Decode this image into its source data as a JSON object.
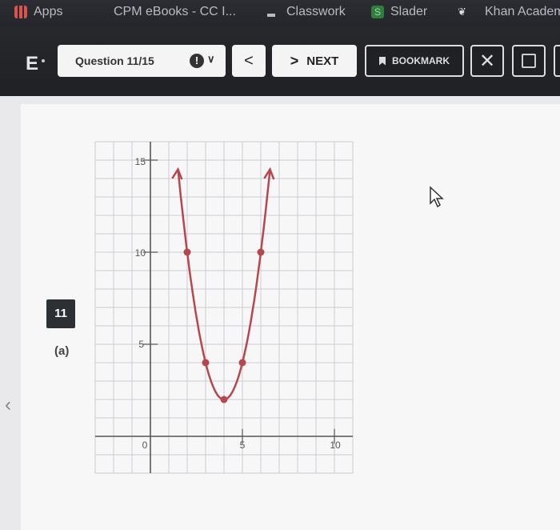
{
  "bookmarks_bar": {
    "items": [
      {
        "label": "Apps",
        "icon": "apps-grid-icon",
        "color": "#d9534f"
      },
      {
        "label": "CPM eBooks - CC I...",
        "icon": "cpm-icon",
        "color": "#888888"
      },
      {
        "label": "Classwork",
        "icon": "classroom-icon",
        "color": "#bbbbbb"
      },
      {
        "label": "Slader",
        "icon": "slader-icon",
        "color": "#3aa655"
      },
      {
        "label": "Khan Academ",
        "icon": "khan-academy-icon",
        "color": "#dddddd"
      }
    ]
  },
  "toolbar": {
    "logo": "E",
    "question_label": "Question 11/15",
    "alert_glyph": "!",
    "prev_glyph": "<",
    "next_arrow": ">",
    "next_label": "NEXT",
    "bookmark_label": "BOOKMARK",
    "close_glyph": "✕"
  },
  "problem": {
    "number": "11",
    "part": "(a)"
  },
  "graph": {
    "x_ticks": [
      "0",
      "5",
      "10"
    ],
    "y_ticks": [
      "5",
      "10",
      "15"
    ],
    "curve_color": "#b5484e",
    "points": [
      {
        "x": 2,
        "y": 10
      },
      {
        "x": 3,
        "y": 4
      },
      {
        "x": 4,
        "y": 2
      },
      {
        "x": 5,
        "y": 4
      },
      {
        "x": 6,
        "y": 10
      }
    ],
    "vertex": {
      "x": 4,
      "y": 2
    }
  }
}
